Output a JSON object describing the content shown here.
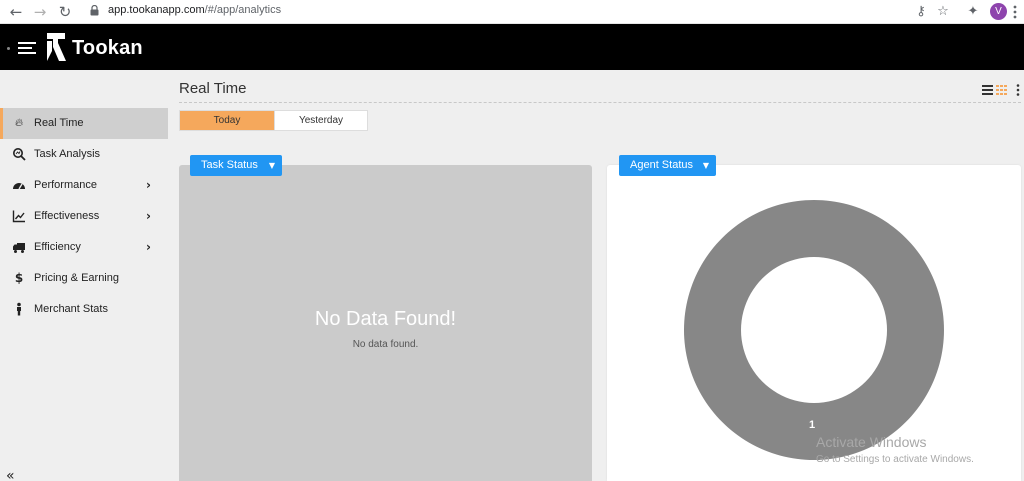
{
  "browser": {
    "url_host": "app.tookanapp.com",
    "url_path": "/#/app/analytics",
    "back_icon": "back-arrow-icon",
    "forward_icon": "forward-arrow-icon",
    "reload_icon": "reload-icon",
    "avatar_letter": "V",
    "avatar_color": "#8e44ad"
  },
  "header": {
    "brand": "Tookan",
    "background": "#000000"
  },
  "sidebar": {
    "items": [
      {
        "label": "Real Time",
        "icon": "flame-icon",
        "active": true,
        "has_submenu": false
      },
      {
        "label": "Task Analysis",
        "icon": "search-analysis-icon",
        "active": false,
        "has_submenu": false
      },
      {
        "label": "Performance",
        "icon": "dashboard-gauge-icon",
        "active": false,
        "has_submenu": true
      },
      {
        "label": "Effectiveness",
        "icon": "line-chart-icon",
        "active": false,
        "has_submenu": true
      },
      {
        "label": "Efficiency",
        "icon": "delivery-truck-icon",
        "active": false,
        "has_submenu": true
      },
      {
        "label": "Pricing & Earning",
        "icon": "dollar-icon",
        "active": false,
        "has_submenu": false
      },
      {
        "label": "Merchant Stats",
        "icon": "person-icon",
        "active": false,
        "has_submenu": false
      }
    ],
    "collapse_glyph": "«",
    "active_accent": "#f5a85c"
  },
  "main": {
    "title": "Real Time",
    "day_toggle": {
      "today": "Today",
      "yesterday": "Yesterday",
      "selected": "Today"
    },
    "task_panel": {
      "dropdown_label": "Task Status",
      "empty_title": "No Data Found!",
      "empty_subtitle": "No data found."
    },
    "agent_panel": {
      "dropdown_label": "Agent Status",
      "donut_label": "1",
      "donut_color": "#878787"
    },
    "accent_blue": "#2196f3"
  },
  "watermark": {
    "line1": "Activate Windows",
    "line2": "Go to Settings to activate Windows."
  }
}
